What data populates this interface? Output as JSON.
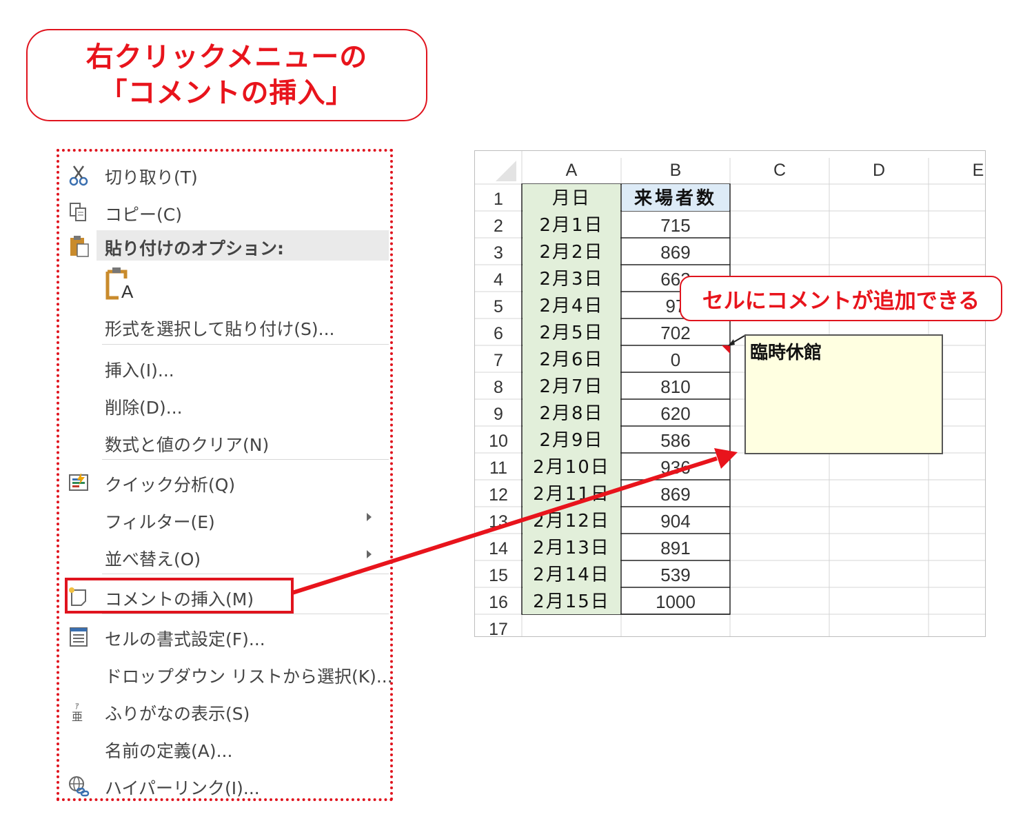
{
  "title": {
    "line1": "右クリックメニューの",
    "line2": "「コメントの挿入」"
  },
  "menu": {
    "items": [
      {
        "label": "切り取り(T)",
        "icon": "scissors-icon"
      },
      {
        "label": "コピー(C)",
        "icon": "copy-icon"
      },
      {
        "label": "貼り付けのオプション:",
        "icon": "clipboard-icon"
      },
      {
        "label": "形式を選択して貼り付け(S)..."
      },
      {
        "label": "挿入(I)..."
      },
      {
        "label": "削除(D)..."
      },
      {
        "label": "数式と値のクリア(N)"
      },
      {
        "label": "クイック分析(Q)",
        "icon": "quick-analysis-icon"
      },
      {
        "label": "フィルター(E)"
      },
      {
        "label": "並べ替え(O)"
      },
      {
        "label": "コメントの挿入(M)",
        "icon": "new-comment-icon"
      },
      {
        "label": "セルの書式設定(F)...",
        "icon": "format-cells-icon"
      },
      {
        "label": "ドロップダウン リストから選択(K)..."
      },
      {
        "label": "ふりがなの表示(S)",
        "icon": "phonetic-icon"
      },
      {
        "label": "名前の定義(A)..."
      },
      {
        "label": "ハイパーリンク(I)...",
        "icon": "hyperlink-icon"
      }
    ],
    "paste_icon_letter": "A"
  },
  "sheet": {
    "columns": [
      "A",
      "B",
      "C",
      "D",
      "E"
    ],
    "rows": [
      "1",
      "2",
      "3",
      "4",
      "5",
      "6",
      "7",
      "8",
      "9",
      "10",
      "11",
      "12",
      "13",
      "14",
      "15",
      "16",
      "17"
    ],
    "header": [
      "月日",
      "来場者数"
    ],
    "data": [
      [
        "2月1日",
        "715"
      ],
      [
        "2月2日",
        "869"
      ],
      [
        "2月3日",
        "662"
      ],
      [
        "2月4日",
        "97"
      ],
      [
        "2月5日",
        "702"
      ],
      [
        "2月6日",
        "0"
      ],
      [
        "2月7日",
        "810"
      ],
      [
        "2月8日",
        "620"
      ],
      [
        "2月9日",
        "586"
      ],
      [
        "2月10日",
        "936"
      ],
      [
        "2月11日",
        "869"
      ],
      [
        "2月12日",
        "904"
      ],
      [
        "2月13日",
        "891"
      ],
      [
        "2月14日",
        "539"
      ],
      [
        "2月15日",
        "1000"
      ]
    ],
    "comment": "臨時休館"
  },
  "callout": "セルにコメントが追加できる",
  "colors": {
    "accent_red": "#e8141c",
    "date_fill": "#e2efda",
    "header_fill": "#ddebf7",
    "comment_fill": "#ffffe1"
  }
}
